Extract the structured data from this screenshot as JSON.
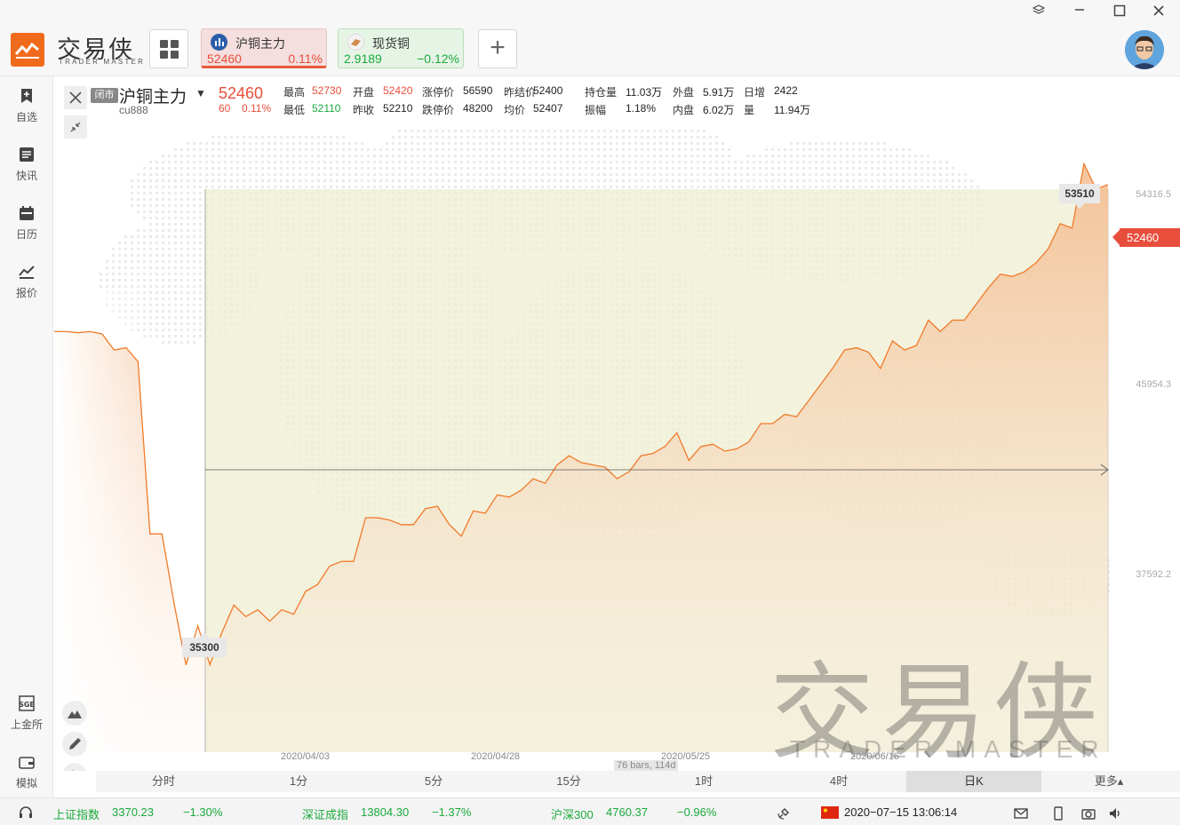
{
  "app": {
    "logo_text": "交易侠",
    "logo_sub": "TRADER MASTER"
  },
  "tabs": [
    {
      "name": "沪铜主力",
      "price": "52460",
      "change": "0.11%"
    },
    {
      "name": "现货铜",
      "price": "2.9189",
      "change": "−0.12%"
    }
  ],
  "sidebar": {
    "items": [
      {
        "label": "自选",
        "icon": "bookmark-plus-icon"
      },
      {
        "label": "快讯",
        "icon": "news-list-icon"
      },
      {
        "label": "日历",
        "icon": "calendar-icon"
      },
      {
        "label": "报价",
        "icon": "trend-line-icon"
      },
      {
        "label": "上金所",
        "icon": "sge-icon"
      },
      {
        "label": "模拟",
        "icon": "wallet-icon"
      }
    ]
  },
  "quote": {
    "status": "闭市",
    "name": "沪铜主力",
    "code": "cu888",
    "price": "52460",
    "change_abs": "60",
    "change_pct": "0.11%",
    "stats_row1": [
      {
        "label": "最高",
        "value": "52730",
        "color": "red"
      },
      {
        "label": "开盘",
        "value": "52420",
        "color": "red"
      },
      {
        "label": "涨停价",
        "value": "56590",
        "color": "dark"
      },
      {
        "label": "昨结价",
        "value": "52400",
        "color": "dark"
      },
      {
        "label": "持仓量",
        "value": "11.03万",
        "color": "dark"
      },
      {
        "label": "外盘",
        "value": "5.91万",
        "color": "dark"
      },
      {
        "label": "日增",
        "value": "2422",
        "color": "dark"
      }
    ],
    "stats_row2": [
      {
        "label": "最低",
        "value": "52110",
        "color": "green"
      },
      {
        "label": "昨收",
        "value": "52210",
        "color": "dark"
      },
      {
        "label": "跌停价",
        "value": "48200",
        "color": "dark"
      },
      {
        "label": "均价",
        "value": "52407",
        "color": "dark"
      },
      {
        "label": "振幅",
        "value": "1.18%",
        "color": "dark"
      },
      {
        "label": "内盘",
        "value": "6.02万",
        "color": "dark"
      },
      {
        "label": "量",
        "value": "11.94万",
        "color": "dark"
      }
    ]
  },
  "chart_data": {
    "type": "area",
    "y_ticks": [
      "54316.5",
      "45954.3",
      "37592.2"
    ],
    "x_ticks": [
      "2020/04/03",
      "2020/04/28",
      "2020/05/25",
      "2020/06/16"
    ],
    "ylim": [
      31500,
      56000
    ],
    "high_label": "53510",
    "low_label": "35300",
    "last_price": "52460",
    "selection_label": "76 bars, 114d",
    "values": [
      49800,
      49800,
      49750,
      49800,
      49700,
      49000,
      49100,
      48500,
      41000,
      41000,
      38000,
      35300,
      37000,
      35300,
      36700,
      37900,
      37400,
      37700,
      37200,
      37700,
      37500,
      38500,
      38800,
      39600,
      39800,
      39800,
      41700,
      41700,
      41600,
      41400,
      41400,
      42100,
      42200,
      41400,
      40900,
      42000,
      41900,
      42700,
      42600,
      42900,
      43400,
      43200,
      44000,
      44400,
      44100,
      44000,
      43900,
      43400,
      43700,
      44400,
      44500,
      44800,
      45400,
      44200,
      44800,
      44900,
      44600,
      44700,
      45000,
      45800,
      45800,
      46200,
      46100,
      46800,
      47500,
      48200,
      49000,
      49100,
      48900,
      48200,
      49400,
      49000,
      49200,
      50300,
      49800,
      50300,
      50300,
      51000,
      51700,
      52300,
      52200,
      52400,
      52800,
      53400,
      54500,
      54300,
      57100,
      56000,
      56200
    ]
  },
  "periods": [
    "分时",
    "1分",
    "5分",
    "15分",
    "1时",
    "4时",
    "日K",
    "更多▴"
  ],
  "active_period": "日K",
  "ticker": [
    {
      "name": "上证指数",
      "value": "3370.23",
      "change": "−1.30%"
    },
    {
      "name": "深证成指",
      "value": "13804.30",
      "change": "−1.37%"
    },
    {
      "name": "沪深300",
      "value": "4760.37",
      "change": "−0.96%"
    }
  ],
  "datetime": "2020−07−15 13:06:14",
  "watermark": {
    "main": "交易侠",
    "sub": "TRADER MASTER"
  },
  "colors": {
    "accent": "#f06a1c",
    "up": "#e84e3c",
    "down": "#1aaa3c",
    "line": "#f07a2a"
  }
}
